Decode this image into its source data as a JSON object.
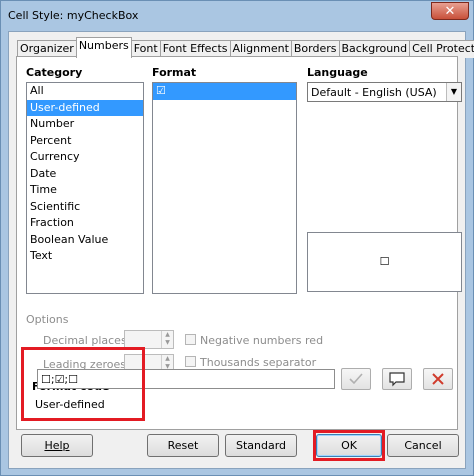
{
  "window": {
    "title": "Cell Style: myCheckBox",
    "close_glyph": "✕"
  },
  "tabs": [
    {
      "label": "Organizer"
    },
    {
      "label": "Numbers",
      "active": true
    },
    {
      "label": "Font"
    },
    {
      "label": "Font Effects"
    },
    {
      "label": "Alignment"
    },
    {
      "label": "Borders"
    },
    {
      "label": "Background"
    },
    {
      "label": "Cell Protection"
    }
  ],
  "category": {
    "label": "Category",
    "items": [
      "All",
      "User-defined",
      "Number",
      "Percent",
      "Currency",
      "Date",
      "Time",
      "Scientific",
      "Fraction",
      "Boolean Value",
      "Text"
    ],
    "selected": "User-defined"
  },
  "format": {
    "label": "Format",
    "items": [
      "☑"
    ],
    "selected": "☑"
  },
  "language": {
    "label": "Language",
    "value": "Default - English (USA)"
  },
  "preview": {
    "text": "☐"
  },
  "options": {
    "label": "Options",
    "decimal_places": "Decimal places:",
    "leading_zeroes": "Leading zeroes:",
    "negative_red": "Negative numbers red",
    "thousands_sep": "Thousands separator"
  },
  "format_code": {
    "label": "Format code",
    "value": "☐;☑;☐",
    "type_text": "User-defined"
  },
  "buttons": {
    "help": "Help",
    "reset": "Reset",
    "standard": "Standard",
    "ok": "OK",
    "cancel": "Cancel"
  },
  "colors": {
    "selection": "#3399ff",
    "highlight": "#e31b23",
    "delete_icon": "#d03b2c"
  },
  "icons": {
    "add": "checkmark-icon",
    "comment": "comment-icon",
    "delete": "delete-x-icon"
  }
}
